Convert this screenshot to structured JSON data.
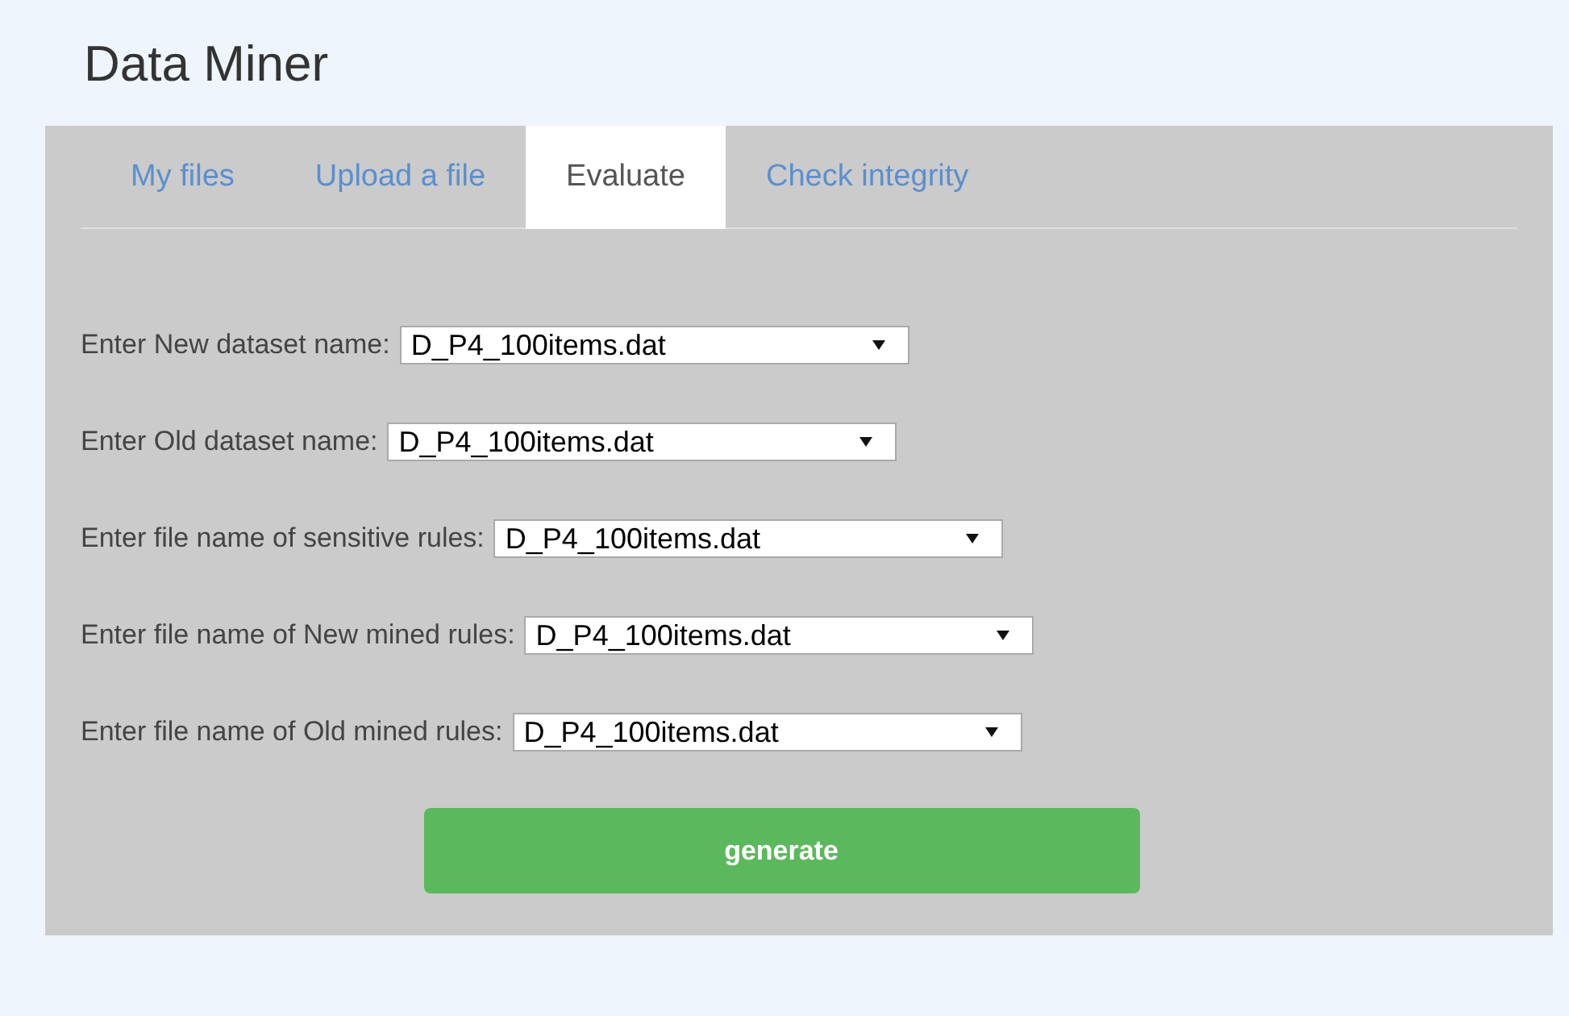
{
  "title": "Data Miner",
  "tabs": [
    {
      "label": "My files",
      "selected": false
    },
    {
      "label": "Upload a file",
      "selected": false
    },
    {
      "label": "Evaluate",
      "selected": true
    },
    {
      "label": "Check integrity",
      "selected": false
    }
  ],
  "fields": [
    {
      "label": "Enter New dataset name:",
      "value": "D_P4_100items.dat"
    },
    {
      "label": "Enter Old dataset name:",
      "value": "D_P4_100items.dat"
    },
    {
      "label": "Enter file name of sensitive rules:",
      "value": "D_P4_100items.dat"
    },
    {
      "label": "Enter file name of New mined rules:",
      "value": "D_P4_100items.dat"
    },
    {
      "label": "Enter file name of Old mined rules:",
      "value": "D_P4_100items.dat"
    }
  ],
  "button": "generate"
}
